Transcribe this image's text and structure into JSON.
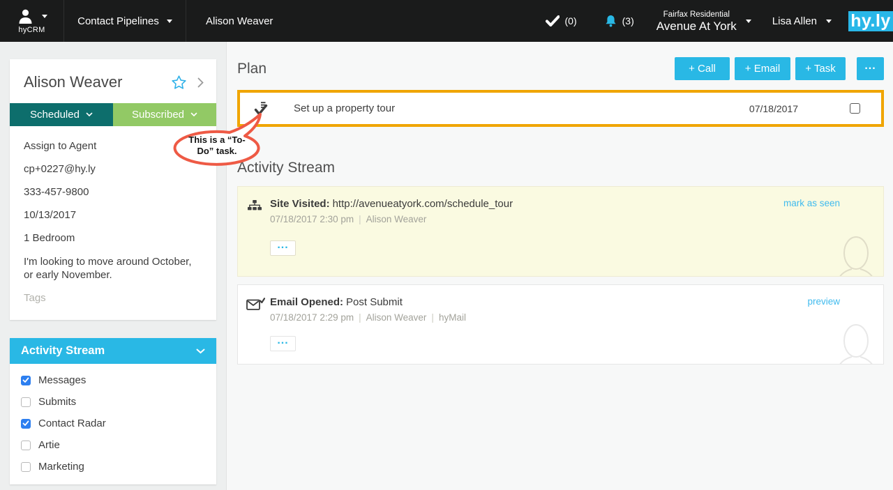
{
  "navbar": {
    "app_label": "hyCRM",
    "pipelines_label": "Contact Pipelines",
    "current_contact": "Alison Weaver",
    "tasks_count": "(0)",
    "alerts_count": "(3)",
    "org_name": "Fairfax Residential",
    "property_name": "Avenue At York",
    "user_name": "Lisa Allen",
    "brand": "hy.ly"
  },
  "contact": {
    "name": "Alison Weaver",
    "pipeline_status": "Scheduled",
    "subscription_status": "Subscribed",
    "assign_label": "Assign to Agent",
    "email": "cp+0227@hy.ly",
    "phone": "333-457-9800",
    "move_date": "10/13/2017",
    "unit_type": "1 Bedroom",
    "note": "I'm looking to move around October, or early November.",
    "tags_placeholder": "Tags"
  },
  "stream_filter": {
    "title": "Activity Stream",
    "options": [
      {
        "label": "Messages",
        "checked": true
      },
      {
        "label": "Submits",
        "checked": false
      },
      {
        "label": "Contact Radar",
        "checked": true
      },
      {
        "label": "Artie",
        "checked": false
      },
      {
        "label": "Marketing",
        "checked": false
      }
    ]
  },
  "plan": {
    "title": "Plan",
    "call_label": "+ Call",
    "email_label": "+ Email",
    "task_label": "+ Task",
    "more_label": "...",
    "task": {
      "title": "Set up a property tour",
      "due_date": "07/18/2017"
    }
  },
  "annotation": {
    "line1": "This is a “To-",
    "line2": "Do” task."
  },
  "activity": {
    "title": "Activity Stream",
    "separator": "|",
    "more_label": "...",
    "items": [
      {
        "label": "Site Visited:",
        "detail": "http://avenueatyork.com/schedule_tour",
        "time": "07/18/2017 2:30 pm",
        "contact": "Alison Weaver",
        "action": "mark as seen"
      },
      {
        "label": "Email Opened:",
        "detail": "Post Submit",
        "time": "07/18/2017 2:29 pm",
        "contact": "Alison Weaver",
        "via": "hyMail",
        "action": "preview"
      }
    ]
  },
  "colors": {
    "accent_cyan": "#29b8e5",
    "navbar_bg": "#1a1b1b",
    "scheduled_teal": "#0d6e6c",
    "subscribed_green": "#92c965",
    "task_highlight_orange": "#f0a500",
    "annotation_red": "#ee5a45",
    "checkbox_blue": "#2d7ff0",
    "unseen_card_bg": "#fafae1"
  }
}
